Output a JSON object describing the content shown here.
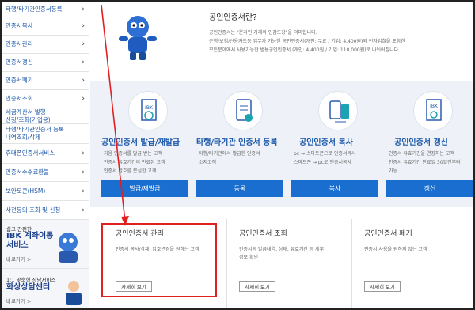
{
  "sidebar": {
    "items": [
      {
        "label": "타행/타기관인증서등록"
      },
      {
        "label": "인증서복사"
      },
      {
        "label": "인증서관리"
      },
      {
        "label": "인증서갱신"
      },
      {
        "label": "인증서폐기"
      },
      {
        "label": "인증서조회"
      },
      {
        "label": "세금계산서 발행\n신청/조회(기업용)"
      },
      {
        "label": "타행/타기관인증서 등록\n내역조회/삭제"
      },
      {
        "label": "휴대폰인증서서비스"
      },
      {
        "label": "인증서수수료환불"
      },
      {
        "label": "보안토큰(HSM)"
      },
      {
        "label": "사전등의 조회 및 신청"
      }
    ],
    "banner1": {
      "line1": "쉽고 간편한",
      "line2a": "IBK 계좌이동",
      "line2b": "서비스",
      "link": "바로가기 >"
    },
    "banner2": {
      "line1": "1:1 맞춤형 상담서비스",
      "line2a": "화상상담센터",
      "link": "바로가기 >"
    }
  },
  "intro": {
    "title": "공인인증서란?",
    "lines": [
      "공인인증서는 \"온라인 거래의 인감도장\"을 의미합니다.",
      "은행/보험/신용카드등 업무가 가능한 공인인증서(개인: 무료 / 기업: 4,400원)와 전자입찰을 포함한",
      "모든분야에서 사용가능한 범용공인인증서 (개인: 4,400원 / 기업: 110,000원)로 나뉘어집니다."
    ]
  },
  "cards": [
    {
      "title": "공인인증서 발급/재발급",
      "desc": [
        "처음 인증서를 발급 받는 고객",
        "인증서 유효기간이 만료된 고객",
        "인증서 암호를 분실한 고객"
      ],
      "button": "발급/재발급"
    },
    {
      "title": "타행/타기관 인증서 등록",
      "desc": [
        "타행/타기관에서 발급한 인증서",
        "소지고객"
      ],
      "button": "등록"
    },
    {
      "title": "공인인증서 복사",
      "desc": [
        "pc → 스마트폰으로 인증서복사",
        "스마트폰 → pc로 인증서복사"
      ],
      "button": "복사"
    },
    {
      "title": "공인인증서 갱신",
      "desc": [
        "인증서 유효기간을 연장하는 고객",
        "인증서 유효기간 만료일 30일전부터",
        "가능"
      ],
      "button": "갱신"
    }
  ],
  "lower": [
    {
      "title": "공인인증서 관리",
      "desc": [
        "인증서 복사/삭제, 암호변경을 원하는 고객"
      ],
      "button": "자세히 보기"
    },
    {
      "title": "공인인증서 조회",
      "desc": [
        "인증서의 발급내역, 상태, 유효기간 등 세부",
        "정보 확인"
      ],
      "button": "자세히 보기"
    },
    {
      "title": "공인인증서 폐기",
      "desc": [
        "인증서 사용을 원하지 않는 고객"
      ],
      "button": "자세히 보기"
    }
  ],
  "colors": {
    "accent": "#1a6ed0",
    "link": "#1a56a8",
    "highlight": "#e02020"
  }
}
